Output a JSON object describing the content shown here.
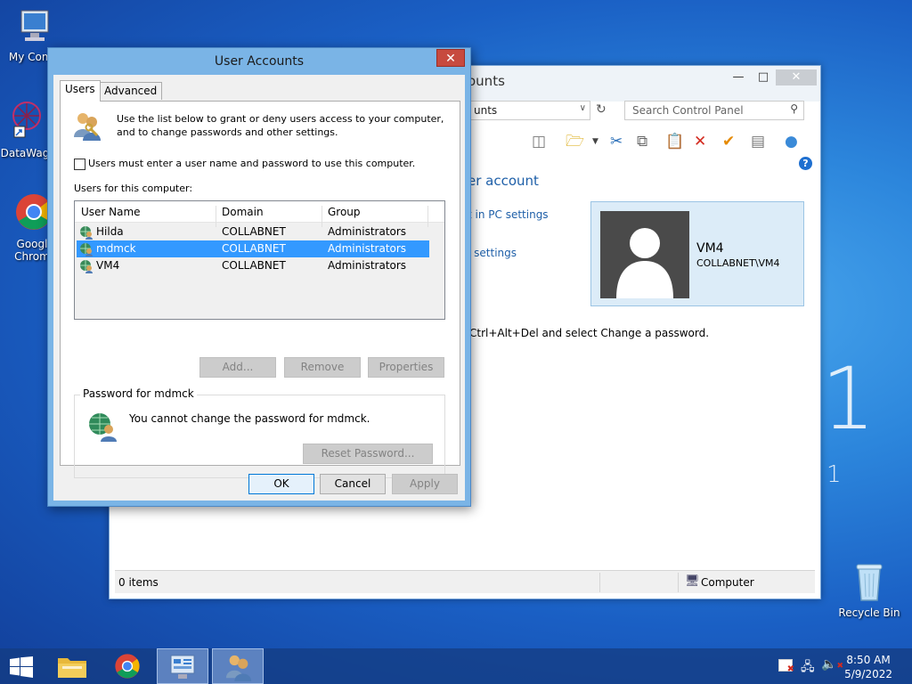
{
  "desktop": {
    "icons": [
      {
        "label": "My Comp"
      },
      {
        "label": "DataWag"
      },
      {
        "label": "Googl\nChrom"
      },
      {
        "label": "Recycle Bin"
      }
    ],
    "watermark_1": "1",
    "watermark_2": "1"
  },
  "control_panel": {
    "title": "ounts",
    "address": "unts",
    "search_placeholder": "Search Control Panel",
    "heading": "er account",
    "link_pc_settings": "t in PC settings",
    "link_settings": "l settings",
    "ctrl_alt_del_text": "Ctrl+Alt+Del and select Change a password.",
    "user_card": {
      "name": "VM4",
      "account": "COLLABNET\\VM4"
    },
    "status_items": "0 items",
    "status_zone": "Computer"
  },
  "dialog": {
    "title": "User Accounts",
    "close_label": "✕",
    "tabs": [
      {
        "label": "Users"
      },
      {
        "label": "Advanced"
      }
    ],
    "intro_text_1": "Use the list below to grant or deny users access to your computer,",
    "intro_text_2": "and to change passwords and other settings.",
    "require_login_label": "Users must enter a user name and password to use this computer.",
    "users_section_label": "Users for this computer:",
    "columns": [
      "User Name",
      "Domain",
      "Group"
    ],
    "users": [
      {
        "name": "Hilda",
        "domain": "COLLABNET",
        "group": "Administrators"
      },
      {
        "name": "mdmck",
        "domain": "COLLABNET",
        "group": "Administrators"
      },
      {
        "name": "VM4",
        "domain": "COLLABNET",
        "group": "Administrators"
      }
    ],
    "buttons": {
      "add": "Add...",
      "remove": "Remove",
      "properties": "Properties",
      "reset_password": "Reset Password...",
      "ok": "OK",
      "cancel": "Cancel",
      "apply": "Apply"
    },
    "password_group_label": "Password for mdmck",
    "password_text": "You cannot change the password for mdmck."
  },
  "taskbar": {
    "time": "8:50 AM",
    "date": "5/9/2022"
  }
}
